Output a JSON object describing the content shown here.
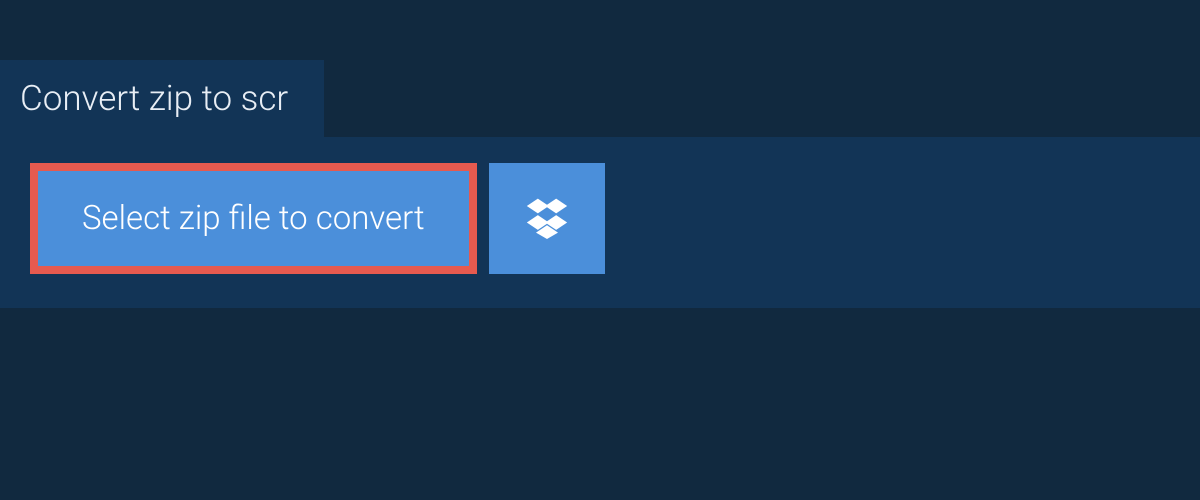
{
  "tab": {
    "label": "Convert zip to scr"
  },
  "actions": {
    "select_label": "Select zip file to convert"
  },
  "colors": {
    "highlight_border": "#e65a4f",
    "button_bg": "#4b8fda",
    "panel_bg": "#123456",
    "page_bg": "#11293f"
  }
}
